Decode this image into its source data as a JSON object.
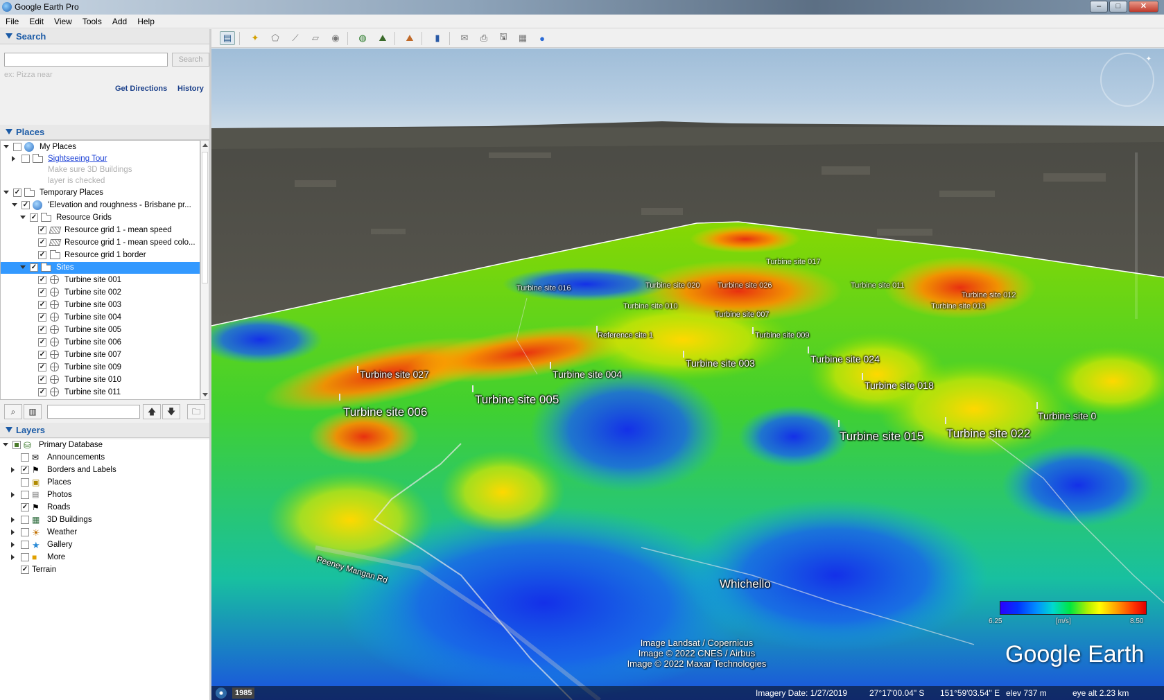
{
  "window": {
    "title": "Google Earth Pro",
    "minimize": "–",
    "maximize": "□",
    "close": "✕"
  },
  "menu": [
    "File",
    "Edit",
    "View",
    "Tools",
    "Add",
    "Help"
  ],
  "search": {
    "header": "Search",
    "placeholder": "",
    "button": "Search",
    "hint": "ex: Pizza near",
    "get_directions": "Get Directions",
    "history": "History"
  },
  "places": {
    "header": "Places",
    "items": [
      {
        "label": "My Places",
        "icon": "globe-icon",
        "checked": false
      },
      {
        "label": "Sightseeing Tour",
        "icon": "folder-icon",
        "checked": false,
        "link": true
      },
      {
        "label": "Make sure 3D Buildings",
        "grey": true
      },
      {
        "label": "layer is checked",
        "grey": true
      },
      {
        "label": "Temporary Places",
        "icon": "folder-open-icon",
        "checked": true
      },
      {
        "label": "'Elevation and roughness - Brisbane pr...",
        "icon": "globe-icon",
        "checked": true
      },
      {
        "label": "Resource Grids",
        "icon": "folder-open-icon",
        "checked": true
      },
      {
        "label": "Resource grid 1 - mean speed",
        "icon": "grid-icon",
        "checked": true
      },
      {
        "label": "Resource grid 1 - mean speed colo...",
        "icon": "grid-icon",
        "checked": true
      },
      {
        "label": "Resource grid 1 border",
        "icon": "folder-icon",
        "checked": true
      },
      {
        "label": "Sites",
        "icon": "folder-open-icon",
        "checked": true,
        "selected": true
      },
      {
        "label": "Turbine site 001",
        "icon": "target-icon",
        "checked": true
      },
      {
        "label": "Turbine site 002",
        "icon": "target-icon",
        "checked": true
      },
      {
        "label": "Turbine site 003",
        "icon": "target-icon",
        "checked": true
      },
      {
        "label": "Turbine site 004",
        "icon": "target-icon",
        "checked": true
      },
      {
        "label": "Turbine site 005",
        "icon": "target-icon",
        "checked": true
      },
      {
        "label": "Turbine site 006",
        "icon": "target-icon",
        "checked": true
      },
      {
        "label": "Turbine site 007",
        "icon": "target-icon",
        "checked": true
      },
      {
        "label": "Turbine site 009",
        "icon": "target-icon",
        "checked": true
      },
      {
        "label": "Turbine site 010",
        "icon": "target-icon",
        "checked": true
      },
      {
        "label": "Turbine site 011",
        "icon": "target-icon",
        "checked": true
      }
    ]
  },
  "layers": {
    "header": "Layers",
    "items": [
      {
        "label": "Primary Database",
        "icon": "database-icon"
      },
      {
        "label": "Announcements",
        "icon": "envelope-icon"
      },
      {
        "label": "Borders and Labels",
        "icon": "flag-icon"
      },
      {
        "label": "Places",
        "icon": "places-icon"
      },
      {
        "label": "Photos",
        "icon": "photo-icon"
      },
      {
        "label": "Roads",
        "icon": "road-icon"
      },
      {
        "label": "3D Buildings",
        "icon": "building-icon"
      },
      {
        "label": "Weather",
        "icon": "weather-icon"
      },
      {
        "label": "Gallery",
        "icon": "star-icon"
      },
      {
        "label": "More",
        "icon": "more-icon"
      },
      {
        "label": "Terrain",
        "icon": ""
      }
    ]
  },
  "map": {
    "labels": {
      "t006": "Turbine site 006",
      "t005": "Turbine site 005",
      "t004": "Turbine site 004",
      "t027": "Turbine site 027",
      "t003": "Turbine site 003",
      "t024": "Turbine site 024",
      "t018": "Turbine site 018",
      "t015": "Turbine site 015",
      "t022": "Turbine site 022",
      "t021": "Turbine site 0",
      "t009": "Turbine site 009",
      "t007": "Turbine site 007",
      "t010": "Turbine site 010",
      "t020": "Turbine site 020",
      "t026": "Turbine site 026",
      "t011": "Turbine site 011",
      "t013": "Turbine site 013",
      "t012": "Turbine site 012",
      "t016": "Turbine site 016",
      "t017": "Turbine site 017",
      "ref": "Reference site 1",
      "whichello": "Whichello",
      "road": "Peeney Mangan Rd"
    },
    "legend": {
      "min": "6.25",
      "unit": "[m/s]",
      "max": "8.50"
    },
    "attribution": [
      "Image Landsat / Copernicus",
      "Image © 2022 CNES / Airbus",
      "Image © 2022 Maxar Technologies"
    ],
    "logo": "Google Earth",
    "status": {
      "year": "1985",
      "imagery_date": "Imagery Date: 1/27/2019",
      "lat": "27°17'00.04\" S",
      "lon": "151°59'03.54\" E",
      "elev": "elev  737 m",
      "eye_alt": "eye alt  2.23 km"
    }
  }
}
